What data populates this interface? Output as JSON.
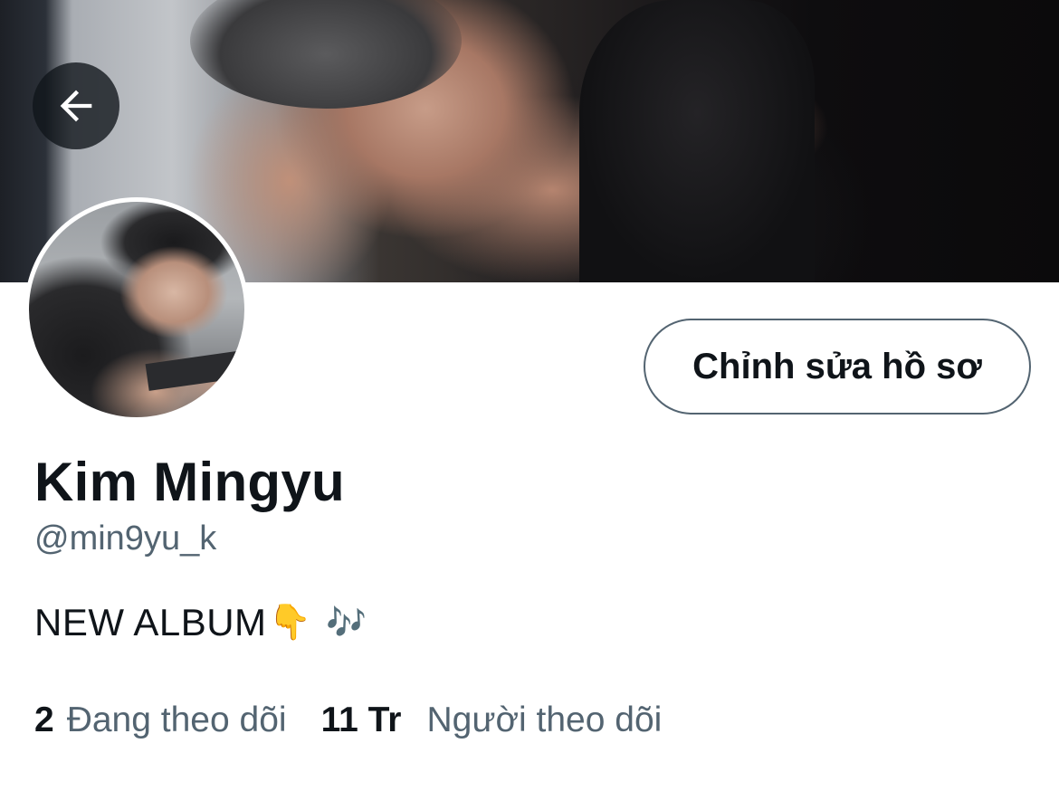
{
  "profile": {
    "display_name": "Kim Mingyu",
    "handle": "@min9yu_k",
    "bio_text": "NEW ALBUM",
    "bio_emoji_1": "👇",
    "bio_emoji_2": "🎶"
  },
  "actions": {
    "edit_profile_label": "Chỉnh sửa hồ sơ",
    "back_icon": "arrow-left-icon"
  },
  "stats": {
    "following_count": "2",
    "following_label": "Đang theo dõi",
    "followers_count": "11 Tr",
    "followers_label": "Người theo dõi"
  },
  "colors": {
    "text_primary": "#0f1419",
    "text_secondary": "#536471",
    "button_border": "#536471",
    "background": "#ffffff"
  }
}
